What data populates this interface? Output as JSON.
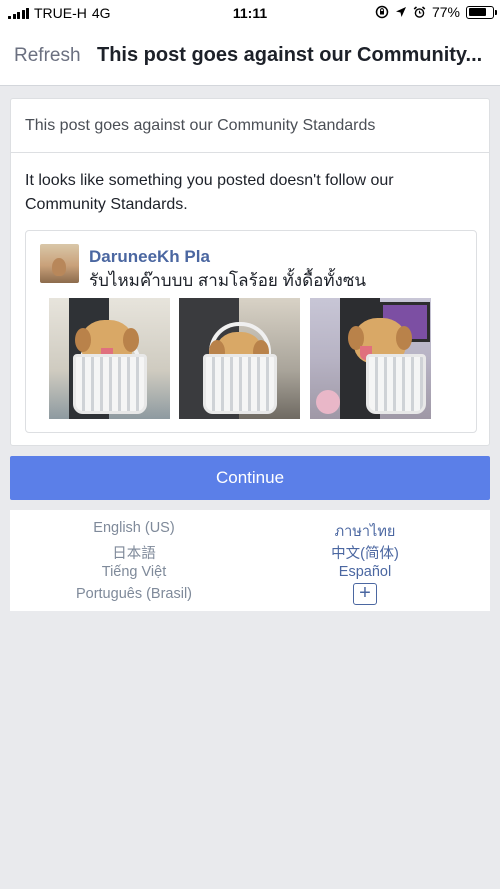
{
  "status_bar": {
    "carrier": "TRUE-H",
    "network": "4G",
    "time": "11:11",
    "battery_percent": "77%",
    "battery_level": 0.77
  },
  "nav": {
    "refresh_label": "Refresh",
    "title": "This post goes against our Community..."
  },
  "card": {
    "header": "This post goes against our Community Standards",
    "message": "It looks like something you posted doesn't follow our Community Standards.",
    "post": {
      "author": "DaruneeKh Pla",
      "text": "รับไหมค๊าบบบ สามโลร้อย ทั้งดื้อทั้งซน"
    }
  },
  "continue_label": "Continue",
  "languages": {
    "left": [
      "English (US)",
      "日本語",
      "Tiếng Việt",
      "Português (Brasil)"
    ],
    "right": [
      "ภาษาไทย",
      "中文(简体)",
      "Español"
    ],
    "more_label": "+"
  },
  "colors": {
    "accent": "#5b7fe8",
    "link": "#4b67a1",
    "background": "#e9eaed"
  }
}
